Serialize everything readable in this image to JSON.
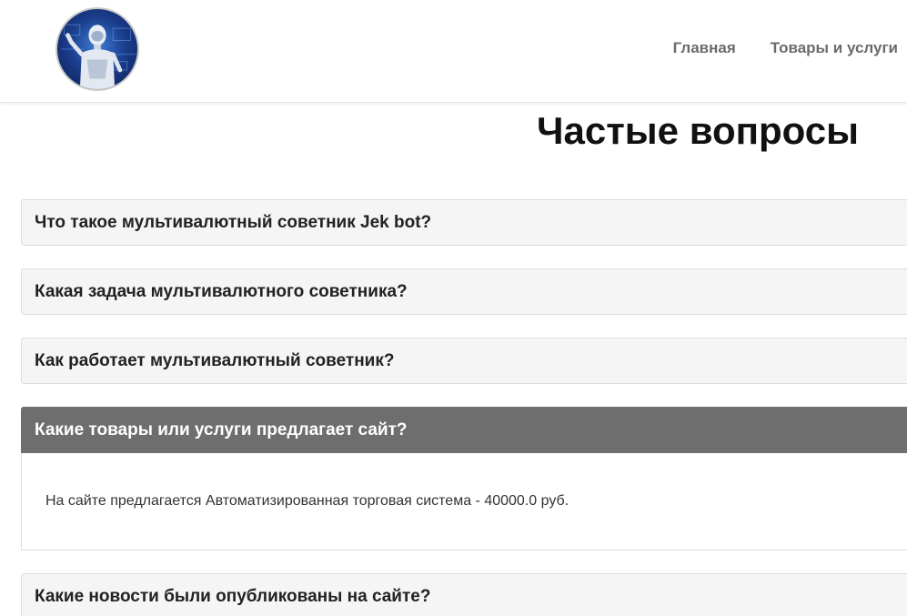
{
  "header": {
    "logo_alt": "robot-logo",
    "nav": [
      {
        "label": "Главная"
      },
      {
        "label": "Товары и услуги"
      }
    ]
  },
  "page": {
    "title": "Частые вопросы"
  },
  "faq": [
    {
      "question": "Что такое мультивалютный советник Jek bot?",
      "expanded": false
    },
    {
      "question": "Какая задача мультивалютного советника?",
      "expanded": false
    },
    {
      "question": "Как работает мультивалютный советник?",
      "expanded": false
    },
    {
      "question": "Какие товары или услуги предлагает сайт?",
      "expanded": true,
      "answer": "На сайте предлагается Автоматизированная торговая система - 40000.0 руб."
    },
    {
      "question": "Какие новости были опубликованы на сайте?",
      "expanded": false
    }
  ],
  "colors": {
    "accent_header_bg": "#6e6e6e",
    "item_bg": "#f5f5f5",
    "nav_text": "#6b6b6b"
  }
}
